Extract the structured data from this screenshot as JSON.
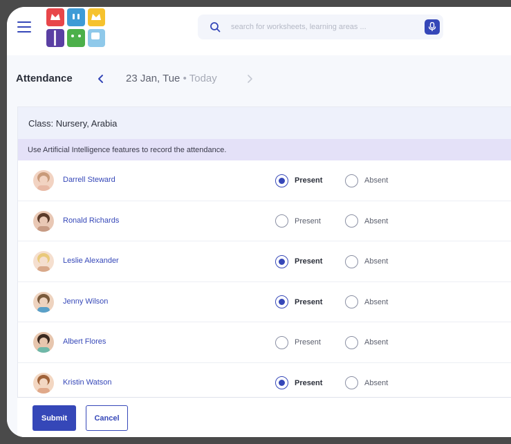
{
  "search": {
    "placeholder": "search for worksheets, learning areas ..."
  },
  "attendance": {
    "title": "Attendance",
    "date": "23 Jan, Tue",
    "today_label": "Today",
    "class_label": "Class: Nursery, Arabia",
    "ai_banner": "Use Artificial Intelligence features to record the attendance."
  },
  "options": {
    "present": "Present",
    "absent": "Absent"
  },
  "students": [
    {
      "name": "Darrell Steward",
      "status": "present"
    },
    {
      "name": "Ronald Richards",
      "status": "none"
    },
    {
      "name": "Leslie Alexander",
      "status": "present"
    },
    {
      "name": "Jenny Wilson",
      "status": "present"
    },
    {
      "name": "Albert Flores",
      "status": "none"
    },
    {
      "name": "Kristin Watson",
      "status": "present"
    }
  ],
  "footer": {
    "submit": "Submit",
    "cancel": "Cancel"
  },
  "colors": {
    "accent": "#3547b8",
    "logo_red": "#e8464a",
    "logo_blue": "#3e9bd6",
    "logo_yellow": "#f6c22e",
    "logo_purple": "#5a3fa3",
    "logo_green": "#4cb04a",
    "logo_lightblue": "#8fc9ea"
  },
  "icons": {
    "menu": "hamburger-icon",
    "search": "search-icon",
    "mic": "microphone-icon",
    "prev": "chevron-left-icon",
    "next": "chevron-right-icon"
  }
}
